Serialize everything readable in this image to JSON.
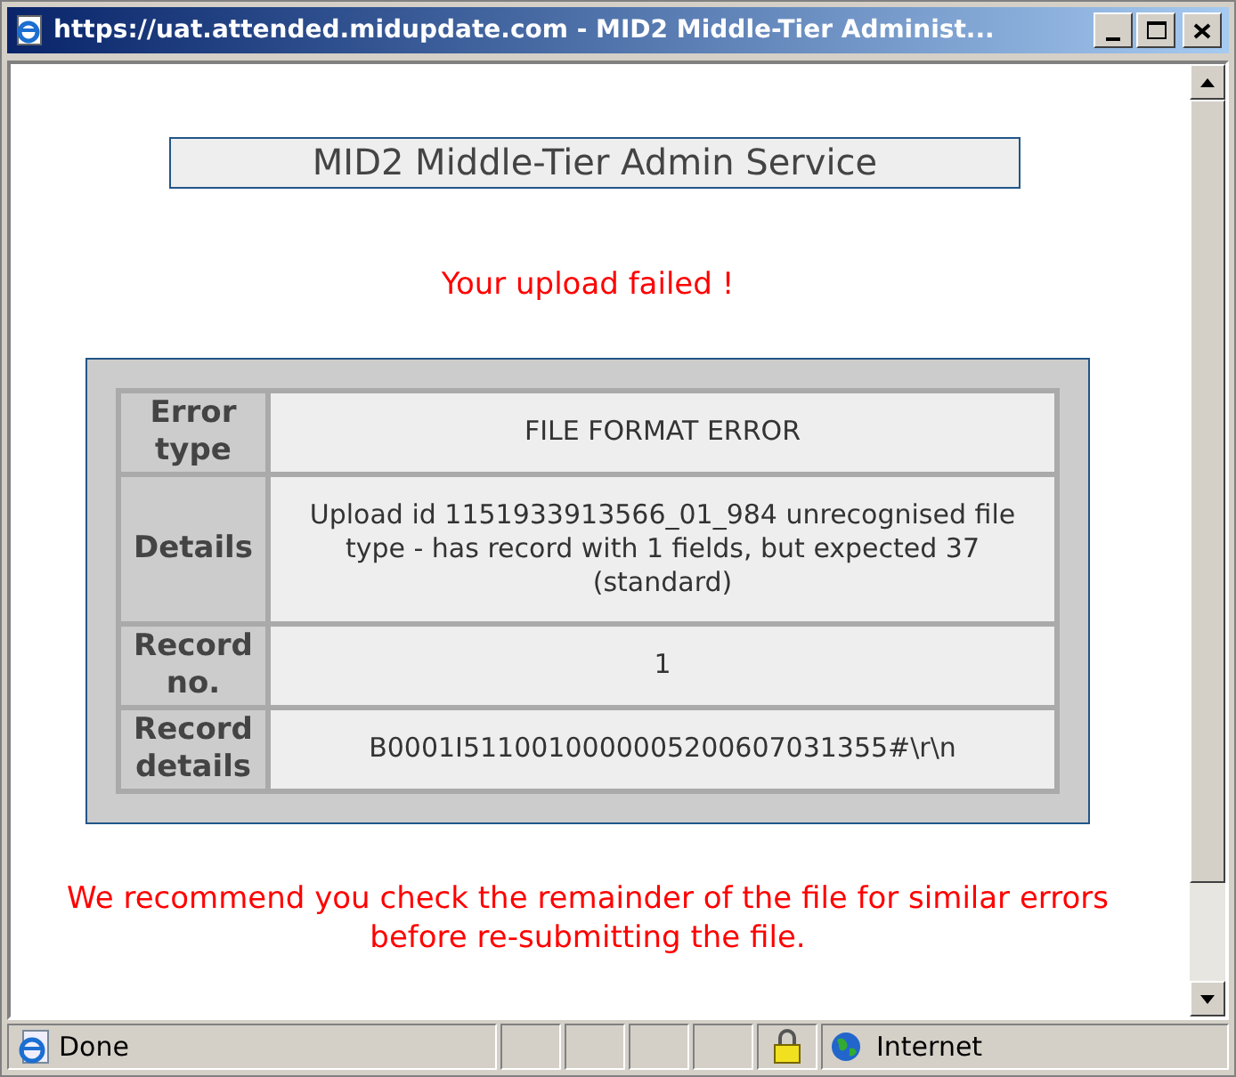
{
  "window": {
    "title": "https://uat.attended.midupdate.com - MID2 Middle-Tier Administ..."
  },
  "page": {
    "heading": "MID2 Middle-Tier Admin Service",
    "message": "Your upload failed !",
    "details": [
      {
        "label": "Error type",
        "value": "FILE FORMAT ERROR"
      },
      {
        "label": "Details",
        "value": "Upload id 1151933913566_01_984 unrecognised file type - has record with 1 fields, but expected 37 (standard)"
      },
      {
        "label": "Record no.",
        "value": "1"
      },
      {
        "label": "Record details",
        "value": "B0001I5110010000005200607031355#\\r\\n"
      }
    ],
    "recommendation": "We recommend you check the remainder of the file for similar errors before re-submitting the file."
  },
  "status_bar": {
    "status": "Done",
    "zone": "Internet"
  }
}
